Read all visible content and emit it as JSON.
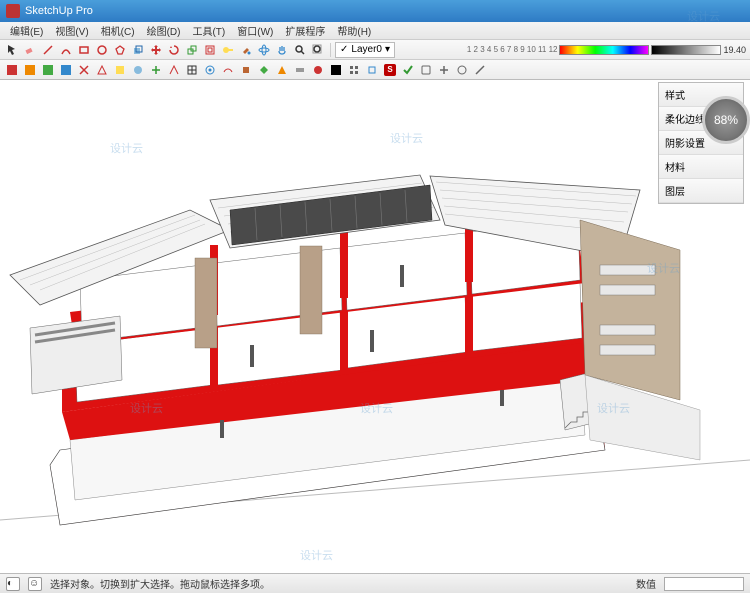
{
  "title": "SketchUp Pro",
  "menu": [
    "编辑(E)",
    "视图(V)",
    "相机(C)",
    "绘图(D)",
    "工具(T)",
    "窗口(W)",
    "扩展程序",
    "帮助(H)"
  ],
  "layer": {
    "checkbox": "✓",
    "name": "Layer0"
  },
  "trays": [
    "样式",
    "柔化边线",
    "阴影设置",
    "材料",
    "图层"
  ],
  "progress": "88%",
  "status": {
    "hint": "选择对象。切换到扩大选择。拖动鼠标选择多项。",
    "label_right": "数值"
  },
  "watermark_text": "设计云",
  "spectrum_labels": "1 2 3 4 5 6 7 8 9 10 11 12",
  "spectrum_end": "19.40"
}
